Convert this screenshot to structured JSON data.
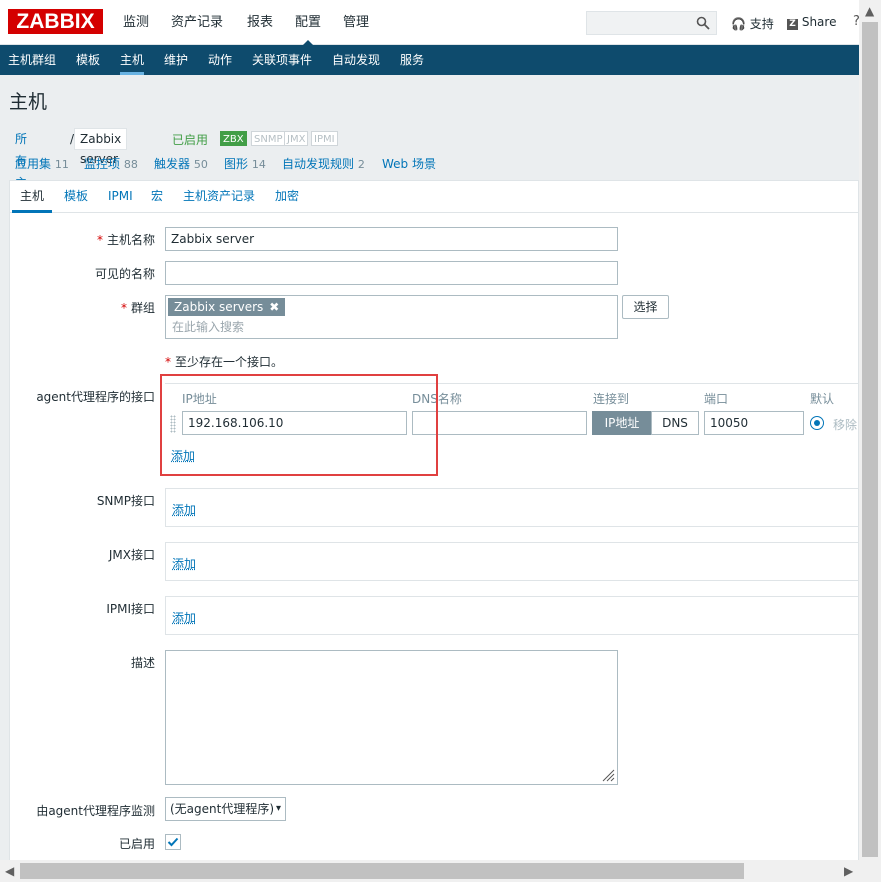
{
  "brand": {
    "logo": "ZABBIX",
    "logo_color": "#d40000"
  },
  "topnav": [
    "监测",
    "资产记录",
    "报表",
    "配置",
    "管理"
  ],
  "topnav_active": "配置",
  "top_right": {
    "support": "支持",
    "share": "Share",
    "help": "?"
  },
  "subnav": [
    "主机群组",
    "模板",
    "主机",
    "维护",
    "动作",
    "关联项事件",
    "自动发现",
    "服务"
  ],
  "subnav_active": "主机",
  "page_title": "主机",
  "breadcrumbs": {
    "all_hosts": "所有主机",
    "separator": "/",
    "current": "Zabbix server"
  },
  "status": "已启用",
  "availability": [
    "ZBX",
    "SNMP",
    "JMX",
    "IPMI"
  ],
  "host_links": [
    {
      "label": "应用集",
      "count": "11"
    },
    {
      "label": "监控项",
      "count": "88"
    },
    {
      "label": "触发器",
      "count": "50"
    },
    {
      "label": "图形",
      "count": "14"
    },
    {
      "label": "自动发现规则",
      "count": "2"
    },
    {
      "label": "Web 场景",
      "count": ""
    }
  ],
  "tabs": [
    "主机",
    "模板",
    "IPMI",
    "宏",
    "主机资产记录",
    "加密"
  ],
  "tab_active": "主机",
  "form": {
    "host_name_label": "主机名称",
    "host_name_value": "Zabbix server",
    "visible_name_label": "可见的名称",
    "visible_name_value": "",
    "groups_label": "群组",
    "group_chip": "Zabbix servers",
    "group_chip_remove": "✖",
    "group_search_placeholder": "在此输入搜索",
    "select_button": "选择",
    "interface_note": "至少存在一个接口。",
    "agent_label": "agent代理程序的接口",
    "columns": {
      "ip": "IP地址",
      "dns": "DNS名称",
      "connect": "连接到",
      "port": "端口",
      "default": "默认"
    },
    "agent_ip": "192.168.106.10",
    "agent_dns": "",
    "connect_ip": "IP地址",
    "connect_dns": "DNS",
    "agent_port": "10050",
    "remove": "移除",
    "add": "添加",
    "snmp_label": "SNMP接口",
    "jmx_label": "JMX接口",
    "ipmi_label": "IPMI接口",
    "description_label": "描述",
    "proxy_label": "由agent代理程序监测",
    "proxy_value": "(无agent代理程序)",
    "enabled_label": "已启用"
  },
  "colors": {
    "nav_bg": "#0e4b6d",
    "link": "#0275b8",
    "enabled_green": "#429e47",
    "highlight": "#e04040"
  }
}
